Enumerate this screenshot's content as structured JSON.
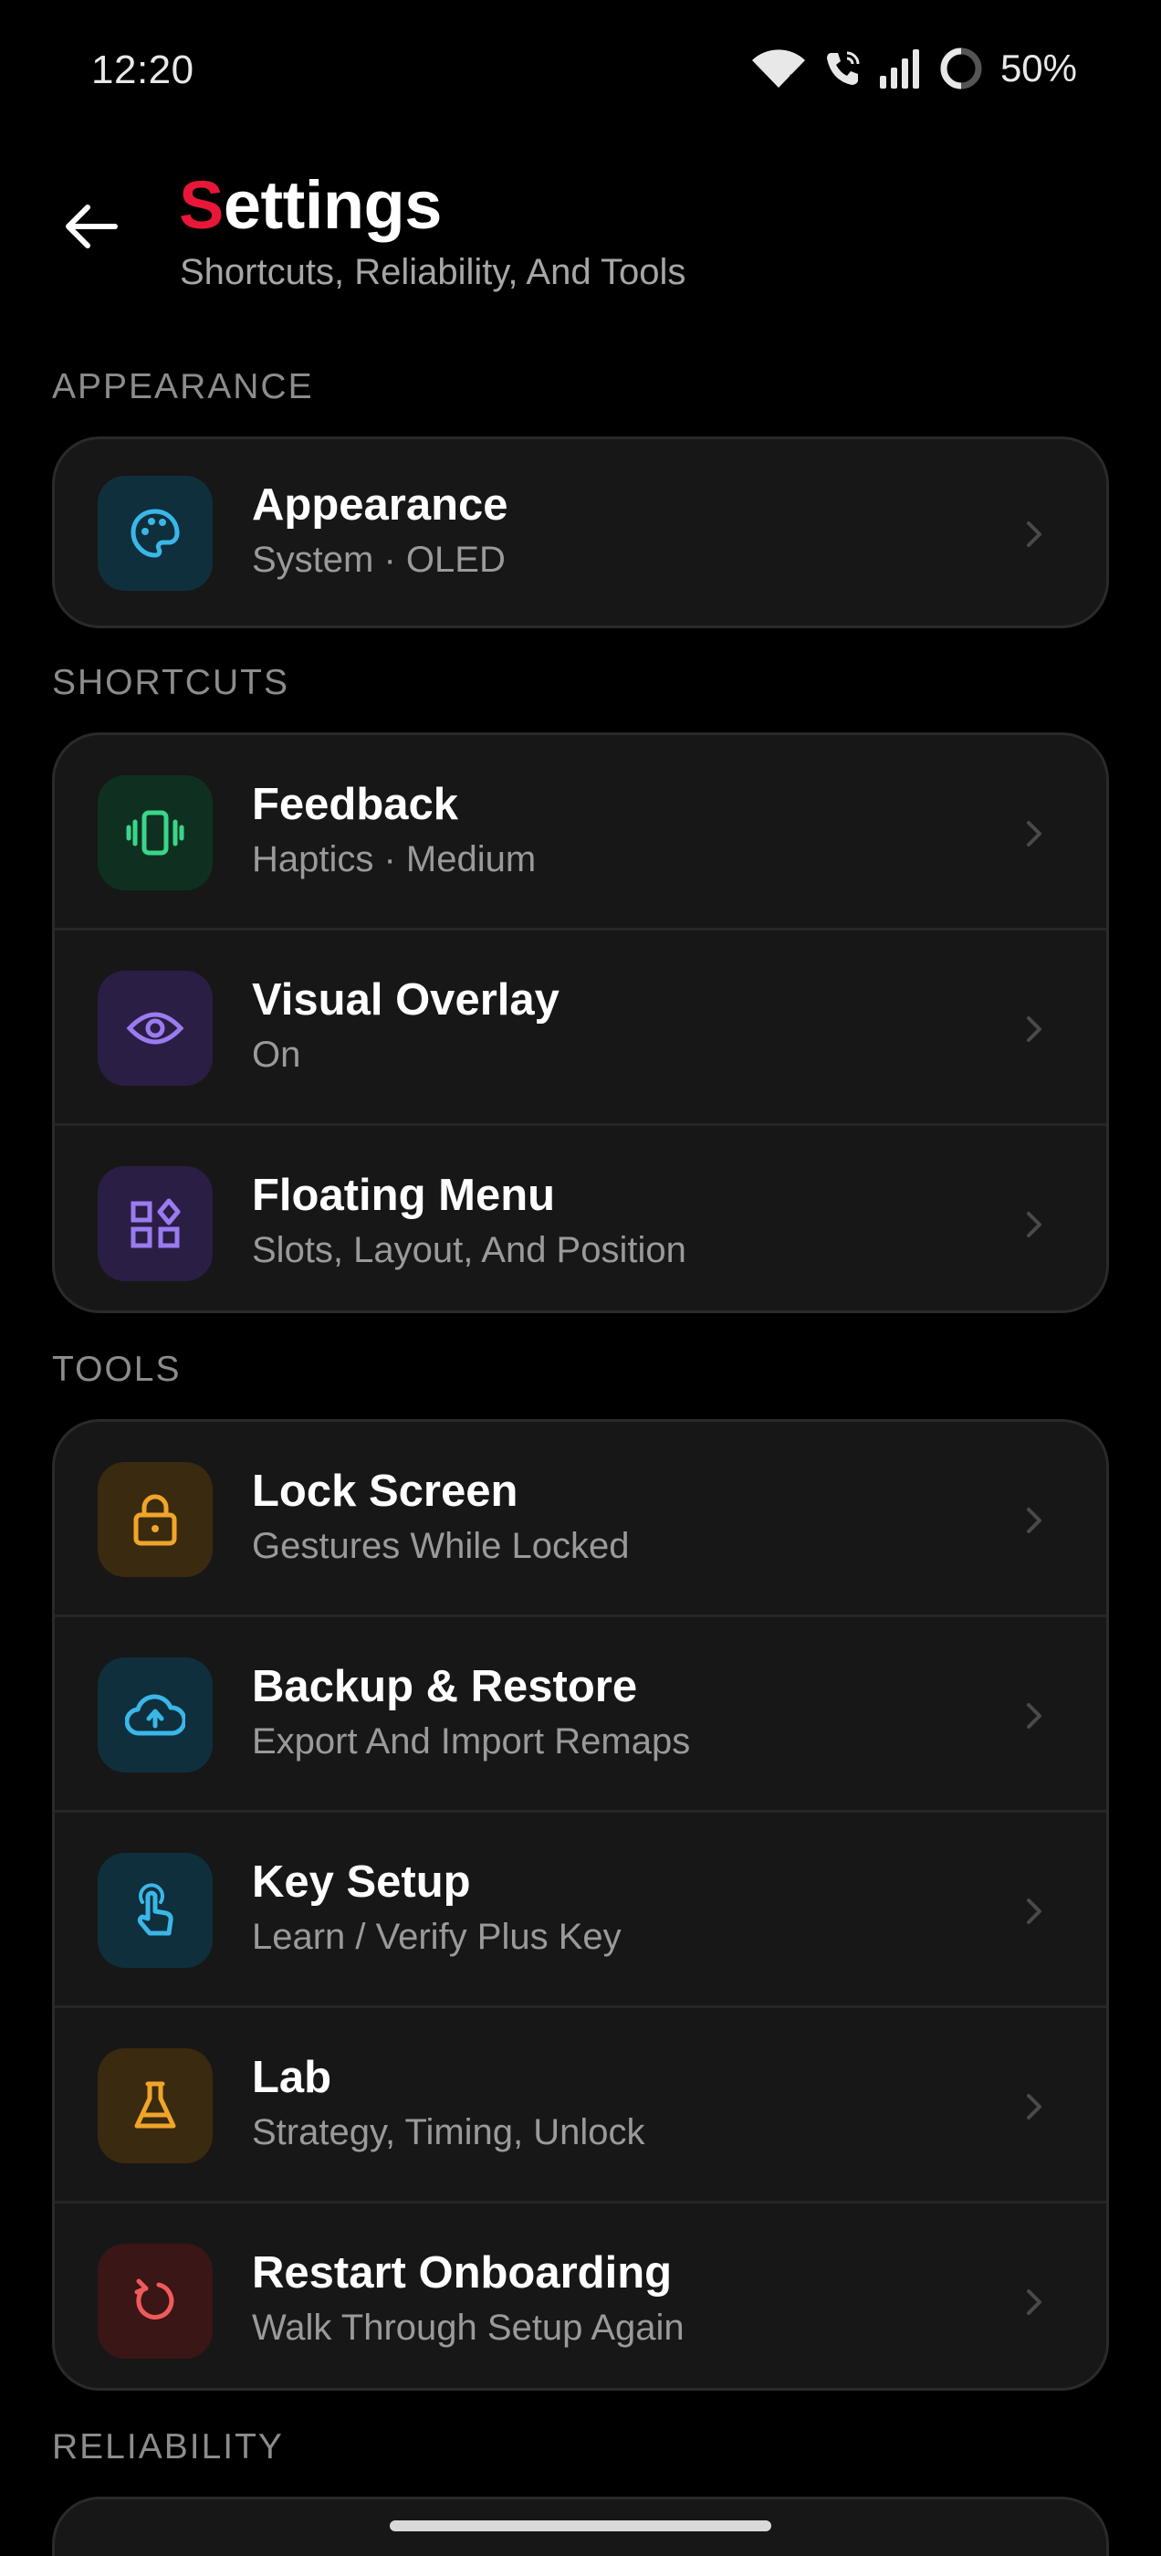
{
  "status_bar": {
    "time": "12:20",
    "battery": "50%",
    "icons": [
      "wifi-icon",
      "wifi-call-icon",
      "cellular-signal-icon",
      "battery-ring-icon"
    ]
  },
  "header": {
    "title_first": "S",
    "title_rest": "ettings",
    "subtitle": "Shortcuts, Reliability, And Tools",
    "back_icon": "arrow-left-icon"
  },
  "colors": {
    "accent": "#e8173a",
    "background": "#000000",
    "card": "#171717"
  },
  "sections": {
    "appearance": {
      "label": "APPEARANCE",
      "items": [
        {
          "title": "Appearance",
          "subtitle": "System · OLED",
          "icon": "palette-icon",
          "icon_color": "#3ab7e8"
        }
      ]
    },
    "shortcuts": {
      "label": "SHORTCUTS",
      "items": [
        {
          "title": "Feedback",
          "subtitle": "Haptics · Medium",
          "icon": "vibration-icon",
          "icon_color": "#3ad68a"
        },
        {
          "title": "Visual Overlay",
          "subtitle": "On",
          "icon": "eye-icon",
          "icon_color": "#9b7bf0"
        },
        {
          "title": "Floating Menu",
          "subtitle": "Slots, Layout, And Position",
          "icon": "widgets-icon",
          "icon_color": "#9b7bf0"
        }
      ]
    },
    "tools": {
      "label": "TOOLS",
      "items": [
        {
          "title": "Lock Screen",
          "subtitle": "Gestures While Locked",
          "icon": "lock-icon",
          "icon_color": "#f0a52a"
        },
        {
          "title": "Backup & Restore",
          "subtitle": "Export And Import Remaps",
          "icon": "cloud-upload-icon",
          "icon_color": "#3ab7e8"
        },
        {
          "title": "Key Setup",
          "subtitle": "Learn / Verify Plus Key",
          "icon": "touch-icon",
          "icon_color": "#3ab7e8"
        },
        {
          "title": "Lab",
          "subtitle": "Strategy, Timing, Unlock",
          "icon": "flask-icon",
          "icon_color": "#f0a52a"
        },
        {
          "title": "Restart Onboarding",
          "subtitle": "Walk Through Setup Again",
          "icon": "restart-icon",
          "icon_color": "#f05a5a"
        }
      ]
    },
    "reliability": {
      "label": "RELIABILITY"
    }
  }
}
